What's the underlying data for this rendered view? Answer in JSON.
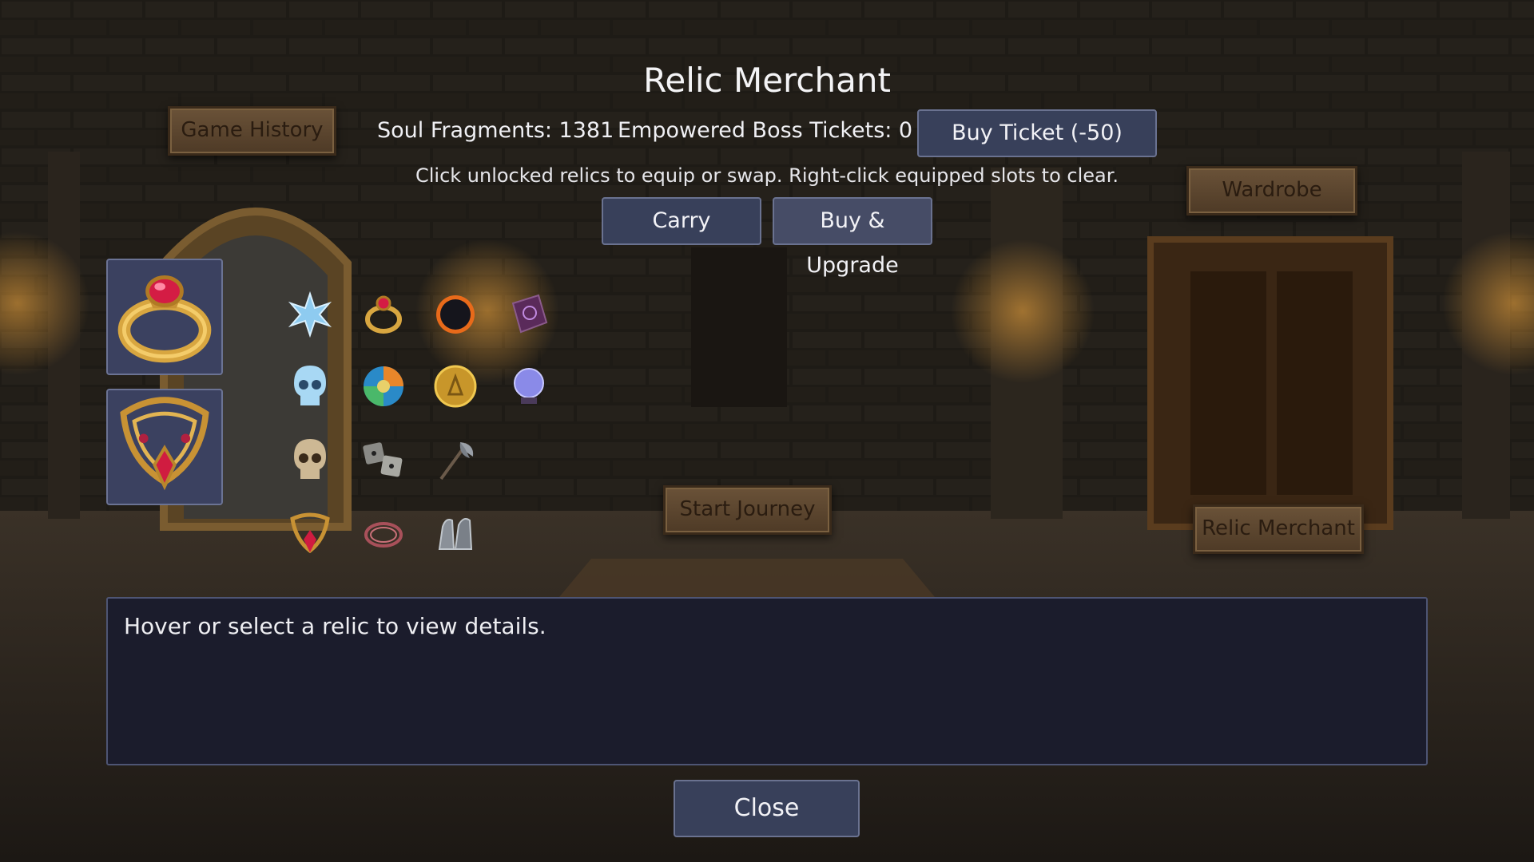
{
  "header": {
    "title": "Relic Merchant",
    "soul_fragments": "Soul Fragments: 1381",
    "boss_tickets": "Empowered Boss Tickets: 0",
    "buy_ticket_label": "Buy Ticket (-50)",
    "hint": "Click unlocked relics to equip or swap. Right-click equipped slots to clear."
  },
  "tabs": [
    {
      "label": "Carry",
      "active": true
    },
    {
      "label": "Buy & Upgrade",
      "active": false
    }
  ],
  "scene_signs": {
    "game_history": "Game History",
    "wardrobe": "Wardrobe",
    "start_journey": "Start Journey",
    "relic_merchant": "Relic Merchant"
  },
  "equipped_slots": [
    {
      "icon": "gold-ruby-ring-icon"
    },
    {
      "icon": "ruby-necklace-icon"
    }
  ],
  "relics": [
    {
      "icon": "ice-crystal-icon"
    },
    {
      "icon": "ruby-ring-icon"
    },
    {
      "icon": "dark-eclipse-orb-icon"
    },
    {
      "icon": "spellbook-icon"
    },
    {
      "icon": "ice-skull-icon"
    },
    {
      "icon": "elemental-orb-icon"
    },
    {
      "icon": "gold-coin-icon"
    },
    {
      "icon": "crystal-ball-icon"
    },
    {
      "icon": "bone-skull-icon"
    },
    {
      "icon": "dice-icon"
    },
    {
      "icon": "battle-axe-icon"
    },
    {
      "icon": "ruby-amulet-icon"
    },
    {
      "icon": "thorn-bracelet-icon"
    },
    {
      "icon": "gauntlets-icon"
    }
  ],
  "details": {
    "text": "Hover or select a relic to view details."
  },
  "close_label": "Close",
  "colors": {
    "panel": "#38405a",
    "details_bg": "#1b1c2c",
    "sign_wood": "#5e472f"
  }
}
